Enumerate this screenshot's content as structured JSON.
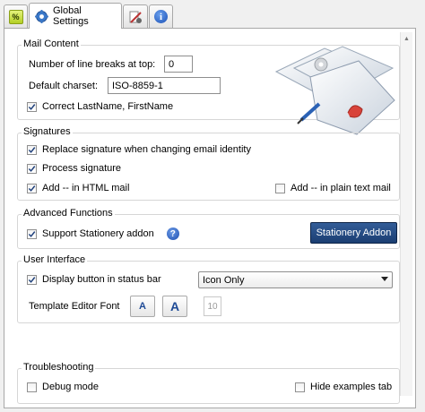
{
  "tabs": [
    {
      "icon": "percent-tab-icon"
    },
    {
      "icon": "gear-icon",
      "label": "Global Settings"
    },
    {
      "icon": "tools-icon"
    },
    {
      "icon": "info-icon"
    }
  ],
  "mail_content": {
    "title": "Mail Content",
    "line_breaks_label": "Number of line breaks at top:",
    "line_breaks_value": "0",
    "charset_label": "Default charset:",
    "charset_value": "ISO-8859-1",
    "correct_name_label": "Correct LastName, FirstName",
    "correct_name_checked": true
  },
  "signatures": {
    "title": "Signatures",
    "replace_label": "Replace signature when changing email identity",
    "replace_checked": true,
    "process_label": "Process signature",
    "process_checked": true,
    "add_html_label": "Add -- in HTML mail",
    "add_html_checked": true,
    "add_plain_label": "Add -- in plain text mail",
    "add_plain_checked": false
  },
  "advanced": {
    "title": "Advanced Functions",
    "stationery_label": "Support Stationery addon",
    "stationery_checked": true,
    "help_glyph": "?",
    "stationery_button": "Stationery Addon"
  },
  "user_interface": {
    "title": "User Interface",
    "status_bar_label": "Display button in status bar",
    "status_bar_checked": true,
    "status_bar_option": "Icon Only",
    "font_label": "Template Editor Font",
    "font_small": "A",
    "font_large": "A",
    "font_size": "10"
  },
  "troubleshooting": {
    "title": "Troubleshooting",
    "debug_label": "Debug mode",
    "debug_checked": false,
    "hide_examples_label": "Hide examples tab",
    "hide_examples_checked": false
  },
  "colors": {
    "accent_button": "#1f4476",
    "link_blue": "#1e4a96",
    "panel_bg": "#ffffff",
    "window_bg": "#f0f0f0"
  }
}
